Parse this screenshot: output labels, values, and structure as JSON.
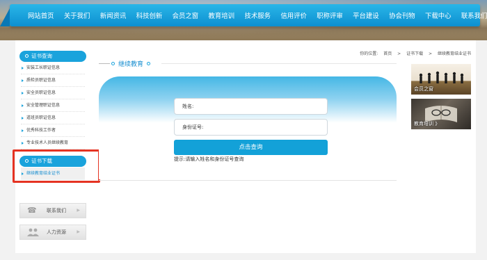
{
  "nav": {
    "items": [
      "网站首页",
      "关于我们",
      "新闻资讯",
      "科技创新",
      "会员之窗",
      "教育培训",
      "技术服务",
      "信用评价",
      "职称评审",
      "平台建设",
      "协会刊物",
      "下载中心",
      "联系我们"
    ]
  },
  "sidebar": {
    "cert_query_title": "证书查询",
    "cert_query_items": [
      "安装工长职证信息",
      "质检员职证信息",
      "安全员职证信息",
      "安全管理职证信息",
      "道班员职证信息",
      "优秀科技工作者",
      "专业技术人员继续教育"
    ],
    "cert_download_title": "证书下载",
    "cert_download_items": [
      "继续教育结业证书"
    ],
    "contact_label": "联系我们",
    "hr_label": "人力资源"
  },
  "breadcrumb": {
    "prefix": "你的位置:",
    "items": [
      "首页",
      "证书下载",
      "继续教育结业证书"
    ],
    "separator": ">"
  },
  "section": {
    "title": "继续教育"
  },
  "form": {
    "name_label": "姓名:",
    "id_label": "身份证号:",
    "submit_label": "点击查询",
    "hint": "提示:请输入姓名和身份证号查询"
  },
  "tiles": {
    "members_caption": "会员之窗",
    "training_caption": "教育培训 》"
  },
  "colors": {
    "accent": "#1aa3dc",
    "highlight": "#e53322"
  }
}
